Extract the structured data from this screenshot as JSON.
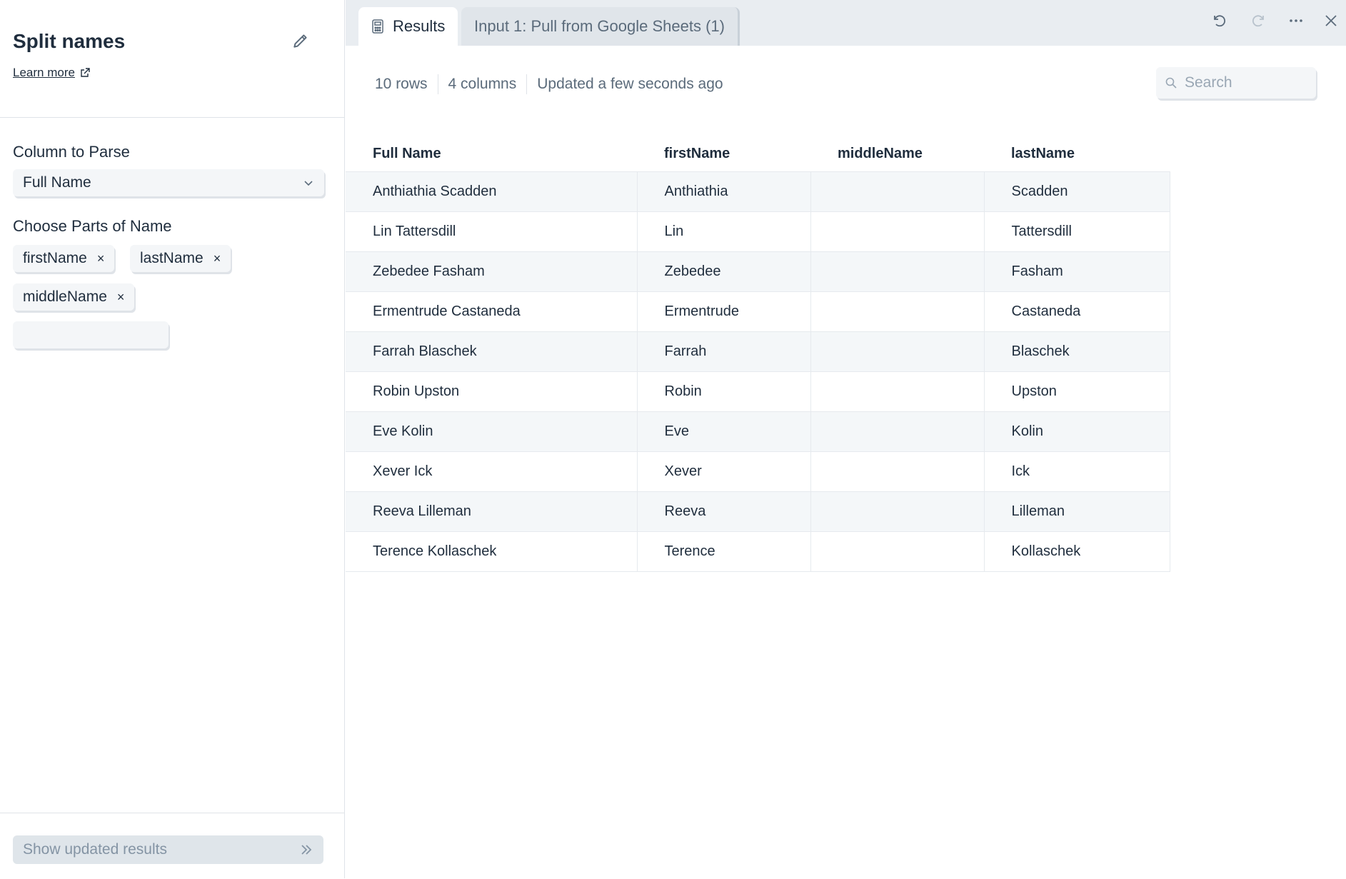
{
  "step": {
    "title": "Split names",
    "learn_more": "Learn more"
  },
  "config": {
    "column_label": "Column to Parse",
    "column_value": "Full Name",
    "parts_label": "Choose Parts of Name",
    "parts": [
      "firstName",
      "lastName",
      "middleName"
    ],
    "remove_symbol": "×",
    "parts_input_value": ""
  },
  "footer": {
    "show_results_label": "Show updated results"
  },
  "tabs": {
    "results": "Results",
    "input": "Input 1: Pull from Google Sheets (1)"
  },
  "meta": {
    "rows": "10 rows",
    "columns": "4 columns",
    "updated": "Updated a few seconds ago"
  },
  "search": {
    "placeholder": "Search"
  },
  "table": {
    "headers": [
      "Full Name",
      "firstName",
      "middleName",
      "lastName"
    ],
    "rows": [
      [
        "Anthiathia Scadden",
        "Anthiathia",
        "",
        "Scadden"
      ],
      [
        "Lin Tattersdill",
        "Lin",
        "",
        "Tattersdill"
      ],
      [
        "Zebedee Fasham",
        "Zebedee",
        "",
        "Fasham"
      ],
      [
        "Ermentrude Castaneda",
        "Ermentrude",
        "",
        "Castaneda"
      ],
      [
        "Farrah Blaschek",
        "Farrah",
        "",
        "Blaschek"
      ],
      [
        "Robin Upston",
        "Robin",
        "",
        "Upston"
      ],
      [
        "Eve Kolin",
        "Eve",
        "",
        "Kolin"
      ],
      [
        "Xever Ick",
        "Xever",
        "",
        "Ick"
      ],
      [
        "Reeva Lilleman",
        "Reeva",
        "",
        "Lilleman"
      ],
      [
        "Terence Kollaschek",
        "Terence",
        "",
        "Kollaschek"
      ]
    ]
  },
  "icons": {
    "edit": "pencil-icon",
    "external": "external-link-icon",
    "chevron": "chevron-down-icon",
    "double_chevron": "double-chevron-right-icon",
    "results_tab": "calculator-icon",
    "undo": "undo-icon",
    "redo": "redo-icon",
    "more": "more-horizontal-icon",
    "close": "close-icon",
    "search": "search-icon"
  },
  "colors": {
    "text": "#1f2d3d",
    "muted": "#5b6b7b",
    "panel_bg": "#e9edf1",
    "row_alt": "#f4f7f9",
    "button_disabled_bg": "#dfe5ea"
  }
}
